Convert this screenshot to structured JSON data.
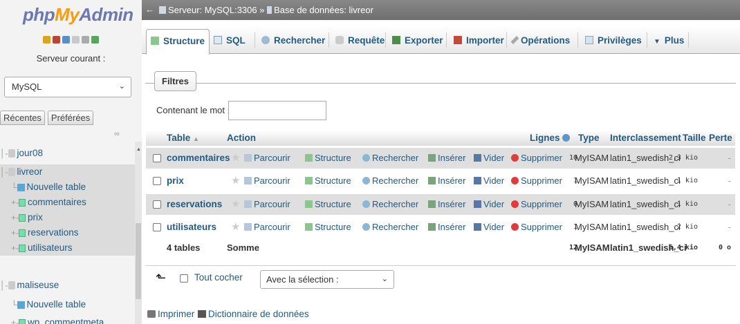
{
  "logo": {
    "php": "php",
    "my": "My",
    "admin": "Admin"
  },
  "left": {
    "server_label": "Serveur courant :",
    "server_value": "MySQL",
    "tabs": [
      "Récentes",
      "Préférées"
    ],
    "tree": [
      {
        "label": "jour08",
        "kind": "db",
        "level": 0
      },
      {
        "label": "livreor",
        "kind": "db",
        "level": 0
      },
      {
        "label": "Nouvelle table",
        "kind": "new",
        "level": 1
      },
      {
        "label": "commentaires",
        "kind": "table",
        "level": 1
      },
      {
        "label": "prix",
        "kind": "table",
        "level": 1
      },
      {
        "label": "reservations",
        "kind": "table",
        "level": 1
      },
      {
        "label": "utilisateurs",
        "kind": "table",
        "level": 1
      },
      {
        "label": "maliseuse",
        "kind": "db",
        "level": 0
      },
      {
        "label": "Nouvelle table",
        "kind": "new",
        "level": 1
      },
      {
        "label": "wp_commentmeta",
        "kind": "table",
        "level": 1
      }
    ]
  },
  "breadcrumb": {
    "server": "Serveur: MySQL:3306",
    "sep": "»",
    "database": "Base de données: livreor"
  },
  "menu": [
    "Structure",
    "SQL",
    "Rechercher",
    "Requête",
    "Exporter",
    "Importer",
    "Opérations",
    "Privilèges",
    "Plus"
  ],
  "filter": {
    "legend": "Filtres",
    "label": "Contenant le mot :"
  },
  "table": {
    "headers": {
      "table": "Table",
      "action": "Action",
      "rows": "Lignes",
      "type": "Type",
      "collation": "Interclassement",
      "size": "Taille",
      "overhead": "Perte"
    },
    "actions": [
      "Parcourir",
      "Structure",
      "Rechercher",
      "Insérer",
      "Vider",
      "Supprimer"
    ],
    "rows": [
      {
        "name": "commentaires",
        "rows": "10",
        "type": "MyISAM",
        "collation": "latin1_swedish_ci",
        "size": "2,3 kio",
        "overhead": "-"
      },
      {
        "name": "prix",
        "rows": "1",
        "type": "MyISAM",
        "collation": "latin1_swedish_ci",
        "size": "1 kio",
        "overhead": "-"
      },
      {
        "name": "reservations",
        "rows": "0",
        "type": "MyISAM",
        "collation": "latin1_swedish_ci",
        "size": "1 kio",
        "overhead": "-"
      },
      {
        "name": "utilisateurs",
        "rows": "1",
        "type": "MyISAM",
        "collation": "latin1_swedish_ci",
        "size": "2 kio",
        "overhead": "-"
      }
    ],
    "total": {
      "name": "4 tables",
      "label": "Somme",
      "rows": "12",
      "type": "MyISAM",
      "collation": "latin1_swedish_ci",
      "size": "6,4 kio",
      "overhead": "0 o"
    }
  },
  "bottom": {
    "check_all": "Tout cocher",
    "with_selected": "Avec la sélection :",
    "print": "Imprimer",
    "dictionary": "Dictionnaire de données"
  }
}
